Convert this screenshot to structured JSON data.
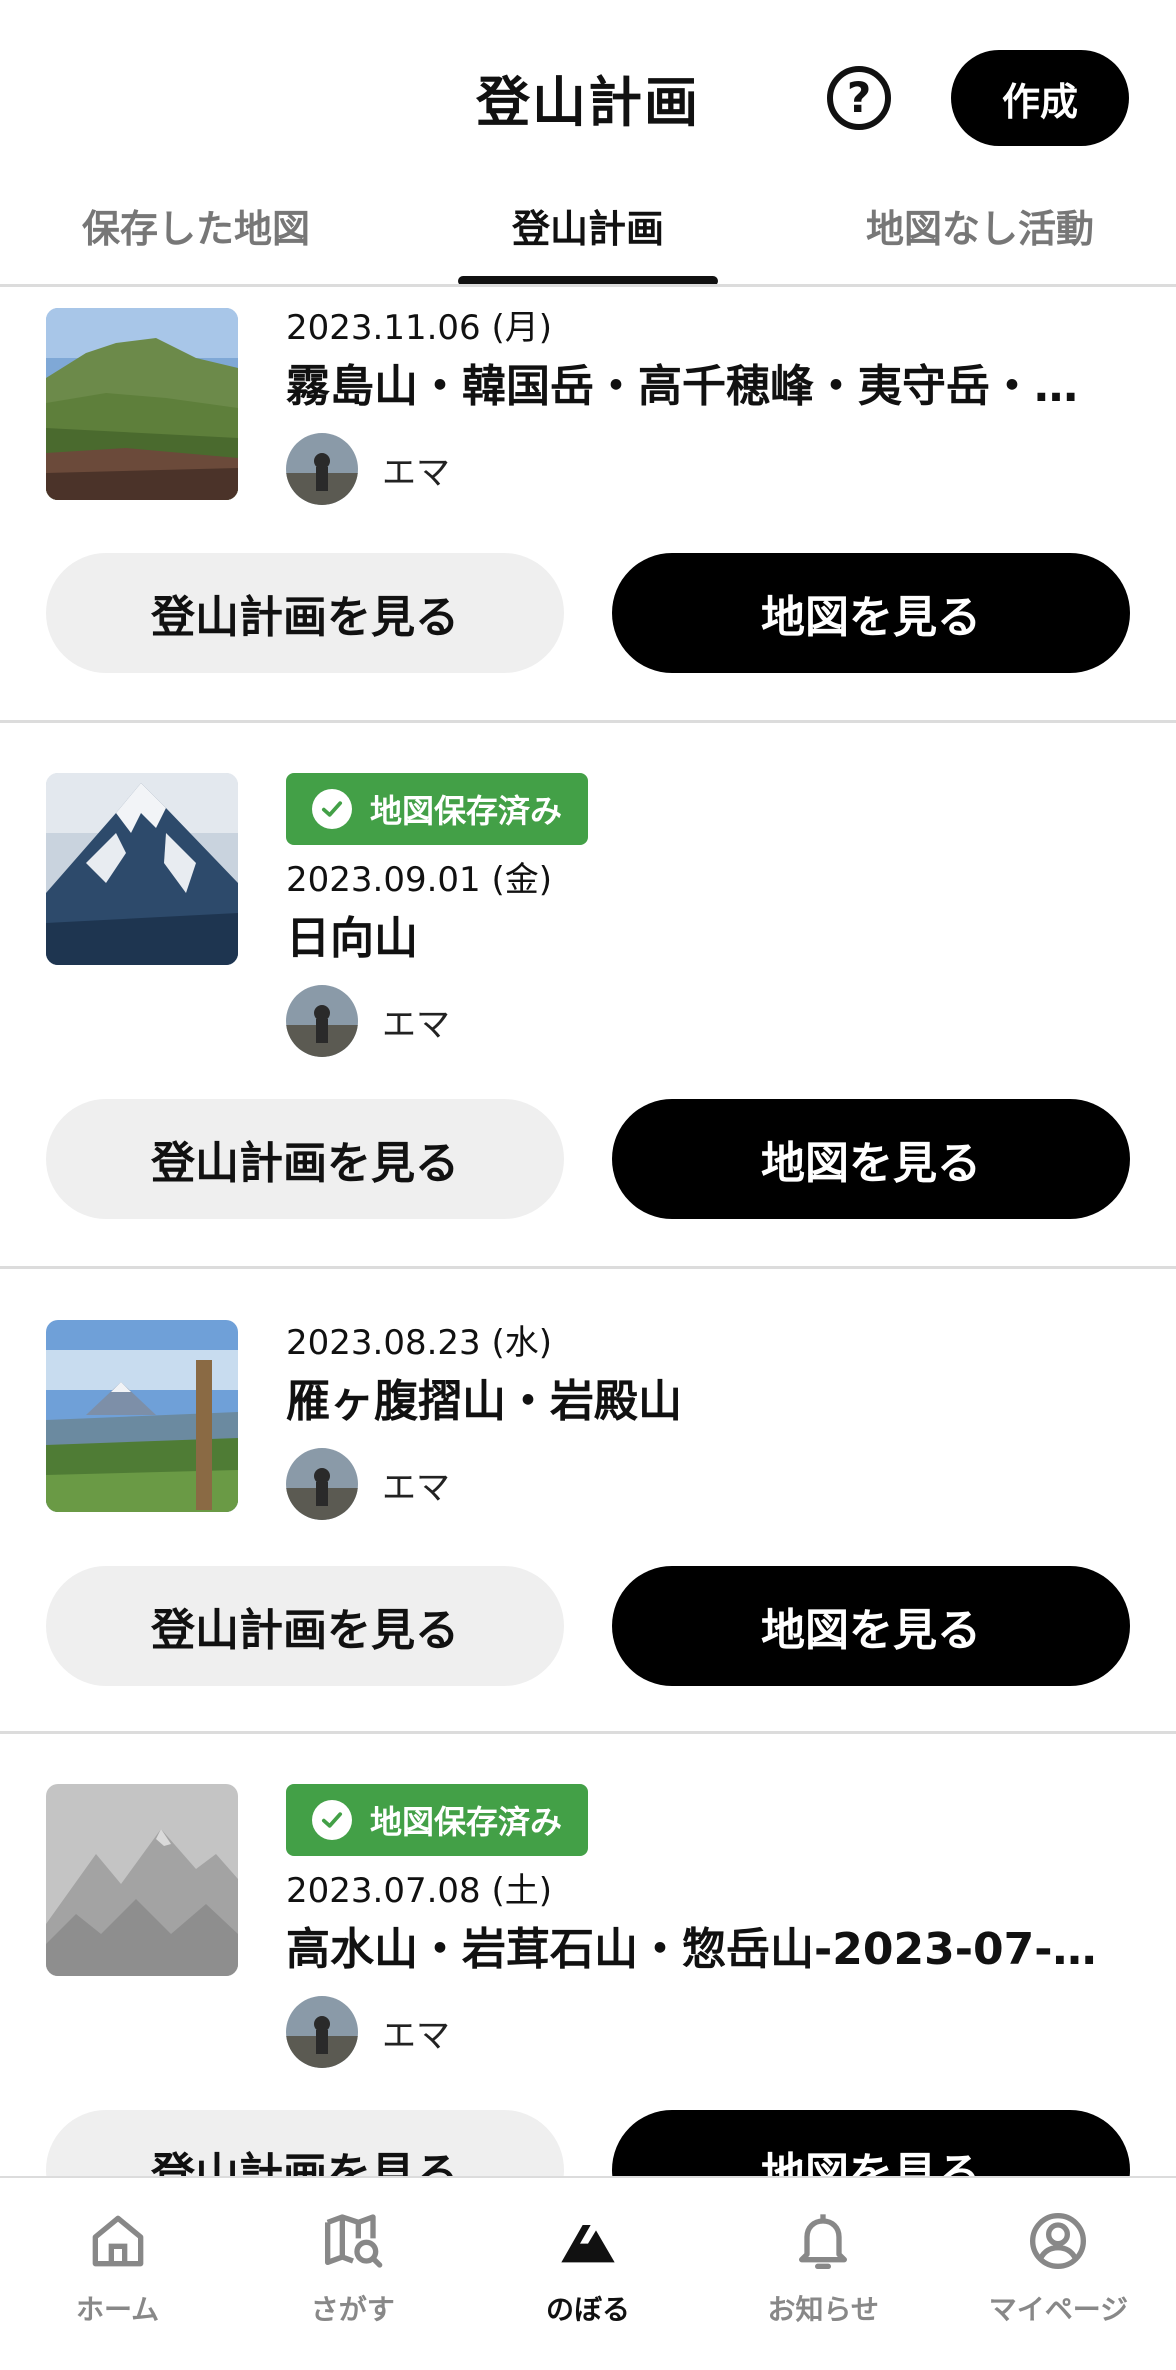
{
  "header": {
    "title": "登山計画",
    "create_label": "作成",
    "help_symbol": "?"
  },
  "tabs": [
    {
      "label": "保存した地図",
      "active": false
    },
    {
      "label": "登山計画",
      "active": true
    },
    {
      "label": "地図なし活動",
      "active": false
    }
  ],
  "plans": [
    {
      "badge": "",
      "date": "2023.11.06 (月)",
      "title": "霧島山・韓国岳・高千穂峰・夷守岳・…",
      "author": "エマ",
      "thumb": "volcano-photo",
      "view_plan_label": "登山計画を見る",
      "view_map_label": "地図を見る"
    },
    {
      "badge": "地図保存済み",
      "date": "2023.09.01 (金)",
      "title": "日向山",
      "author": "エマ",
      "thumb": "snowy-peak-photo",
      "view_plan_label": "登山計画を見る",
      "view_map_label": "地図を見る"
    },
    {
      "badge": "",
      "date": "2023.08.23 (水)",
      "title": "雁ヶ腹摺山・岩殿山",
      "author": "エマ",
      "thumb": "fuji-view-photo",
      "view_plan_label": "登山計画を見る",
      "view_map_label": "地図を見る"
    },
    {
      "badge": "地図保存済み",
      "date": "2023.07.08 (土)",
      "title": "高水山・岩茸石山・惣岳山-2023-07-…",
      "author": "エマ",
      "thumb": "placeholder-mountain",
      "view_plan_label": "登山計画を見る",
      "view_map_label": "地図を見る"
    }
  ],
  "bottom_nav": [
    {
      "label": "ホーム",
      "icon": "home-icon",
      "active": false
    },
    {
      "label": "さがす",
      "icon": "map-search-icon",
      "active": false
    },
    {
      "label": "のぼる",
      "icon": "climb-icon",
      "active": true
    },
    {
      "label": "お知らせ",
      "icon": "bell-icon",
      "active": false
    },
    {
      "label": "マイページ",
      "icon": "user-icon",
      "active": false
    }
  ],
  "colors": {
    "badge_green": "#43a047",
    "primary_black": "#000000",
    "secondary_gray": "#efefef",
    "inactive_text": "#888888"
  }
}
